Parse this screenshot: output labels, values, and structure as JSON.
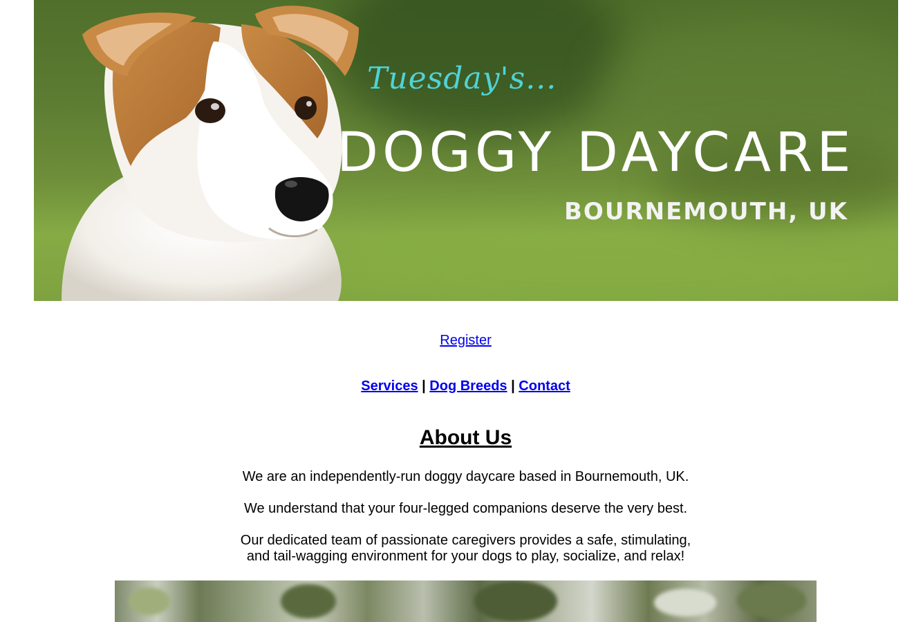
{
  "hero": {
    "script_text": "Tuesday's...",
    "brand": "DOGGY DAYCARE",
    "location": "BOURNEMOUTH, UK"
  },
  "register": {
    "label": "Register"
  },
  "nav": {
    "items": [
      {
        "label": "Services"
      },
      {
        "label": "Dog Breeds"
      },
      {
        "label": "Contact"
      }
    ],
    "separator": "|"
  },
  "about": {
    "title": "About Us",
    "p1": "We are an independently-run doggy daycare based in Bournemouth, UK.",
    "p2": "We understand that your four-legged companions deserve the very best.",
    "p3_line1": "Our dedicated team of passionate caregivers provides a safe, stimulating,",
    "p3_line2": "and tail-wagging environment for your dogs to play, socialize, and relax!"
  },
  "colors": {
    "link": "#0000ee",
    "script_accent": "#4fd3d6",
    "hero_green": "#5d7d33"
  }
}
